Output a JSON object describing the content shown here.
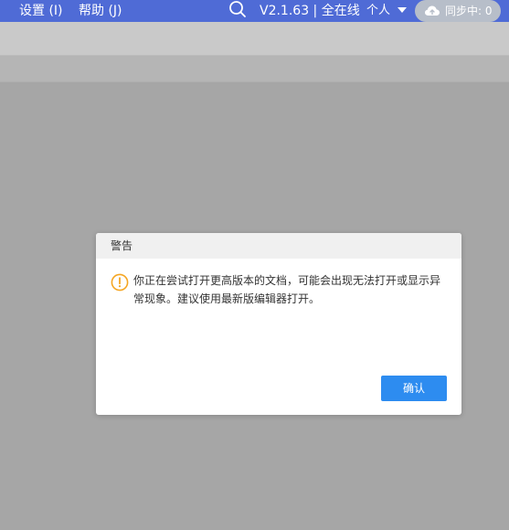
{
  "topbar": {
    "menu_settings": "设置 (I)",
    "menu_help": "帮助 (J)",
    "search_icon": "search-icon",
    "version_status": "V2.1.63 | 全在线",
    "user_menu_label": "个人",
    "sync_status": "同步中: 0"
  },
  "dialog": {
    "title": "警告",
    "message": "你正在尝试打开更高版本的文档，可能会出现无法打开或显示异常现象。建议使用最新版编辑器打开。",
    "confirm_label": "确认",
    "icon": "warning-circle-icon"
  },
  "colors": {
    "topbar_bg": "#4f6bd6",
    "overlay_bg": "#a6a6a6",
    "primary_button": "#2d8cf0",
    "warning_icon": "#f5a623"
  }
}
